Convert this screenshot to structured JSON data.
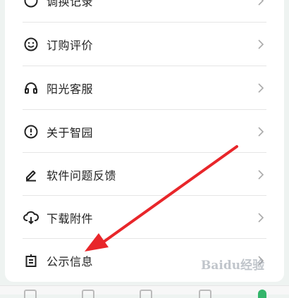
{
  "menu": {
    "items": [
      {
        "label": "调换记录",
        "icon": "swap-icon"
      },
      {
        "label": "订购评价",
        "icon": "smiley-icon"
      },
      {
        "label": "阳光客服",
        "icon": "headset-icon"
      },
      {
        "label": "关于智园",
        "icon": "info-icon"
      },
      {
        "label": "软件问题反馈",
        "icon": "pen-icon"
      },
      {
        "label": "下载附件",
        "icon": "cloud-download-icon"
      },
      {
        "label": "公示信息",
        "icon": "notice-board-icon"
      }
    ]
  },
  "watermark": {
    "text": "Baidu经验"
  },
  "colors": {
    "accent": "#33b56a",
    "arrow": "#e8262a",
    "text": "#222222"
  }
}
